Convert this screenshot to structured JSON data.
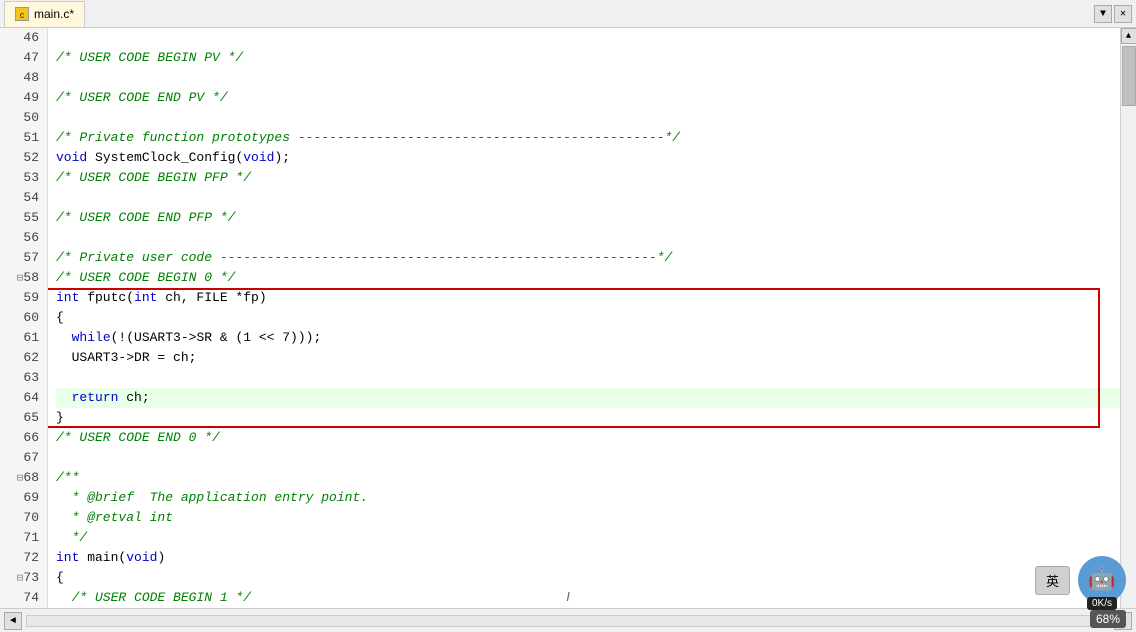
{
  "title_bar": {
    "tab_label": "main.c*",
    "close_btn": "✕",
    "pin_btn": "▼"
  },
  "editor": {
    "lines": [
      {
        "num": 46,
        "content": "",
        "tokens": []
      },
      {
        "num": 47,
        "content": "/* USER CODE BEGIN PV */",
        "type": "comment"
      },
      {
        "num": 48,
        "content": "",
        "tokens": []
      },
      {
        "num": 49,
        "content": "/* USER CODE END PV */",
        "type": "comment"
      },
      {
        "num": 50,
        "content": "",
        "tokens": []
      },
      {
        "num": 51,
        "content": "/* Private function prototypes -----------------------------------------------*/",
        "type": "comment"
      },
      {
        "num": 52,
        "content": "void SystemClock_Config(void);",
        "type": "code"
      },
      {
        "num": 53,
        "content": "/* USER CODE BEGIN PFP */",
        "type": "comment"
      },
      {
        "num": 54,
        "content": "",
        "tokens": []
      },
      {
        "num": 55,
        "content": "/* USER CODE END PFP */",
        "type": "comment"
      },
      {
        "num": 56,
        "content": "",
        "tokens": []
      },
      {
        "num": 57,
        "content": "/* Private user code --------------------------------------------------------*/",
        "type": "comment"
      },
      {
        "num": 58,
        "content": "/* USER CODE BEGIN 0 */",
        "type": "comment",
        "fold": true
      },
      {
        "num": 59,
        "content": "int fputc(int ch, FILE *fp)",
        "type": "code",
        "boxed": true
      },
      {
        "num": 60,
        "content": "{",
        "type": "code",
        "boxed": true
      },
      {
        "num": 61,
        "content": "  while(!(USART3->SR & (1 << 7)));",
        "type": "code",
        "boxed": true
      },
      {
        "num": 62,
        "content": "  USART3->DR = ch;",
        "type": "code",
        "boxed": true
      },
      {
        "num": 63,
        "content": "",
        "type": "code",
        "boxed": true
      },
      {
        "num": 64,
        "content": "  return ch;",
        "type": "code",
        "boxed": true,
        "highlighted": true
      },
      {
        "num": 65,
        "content": "}",
        "type": "code",
        "boxed": true
      },
      {
        "num": 66,
        "content": "/* USER CODE END 0 */",
        "type": "comment"
      },
      {
        "num": 67,
        "content": "",
        "tokens": []
      },
      {
        "num": 68,
        "content": "/**",
        "type": "comment",
        "fold": true
      },
      {
        "num": 69,
        "content": "  * @brief  The application entry point.",
        "type": "comment"
      },
      {
        "num": 70,
        "content": "  * @retval int",
        "type": "comment"
      },
      {
        "num": 71,
        "content": "  */",
        "type": "comment"
      },
      {
        "num": 72,
        "content": "int main(void)",
        "type": "code"
      },
      {
        "num": 73,
        "content": "{",
        "type": "code",
        "fold": true
      },
      {
        "num": 74,
        "content": "  /* USER CODE BEGIN 1 */",
        "type": "comment"
      }
    ]
  },
  "status": {
    "cursor_text": "I",
    "speed_label": "0K/s",
    "percent_label": "68%",
    "lang_btn": "英"
  }
}
